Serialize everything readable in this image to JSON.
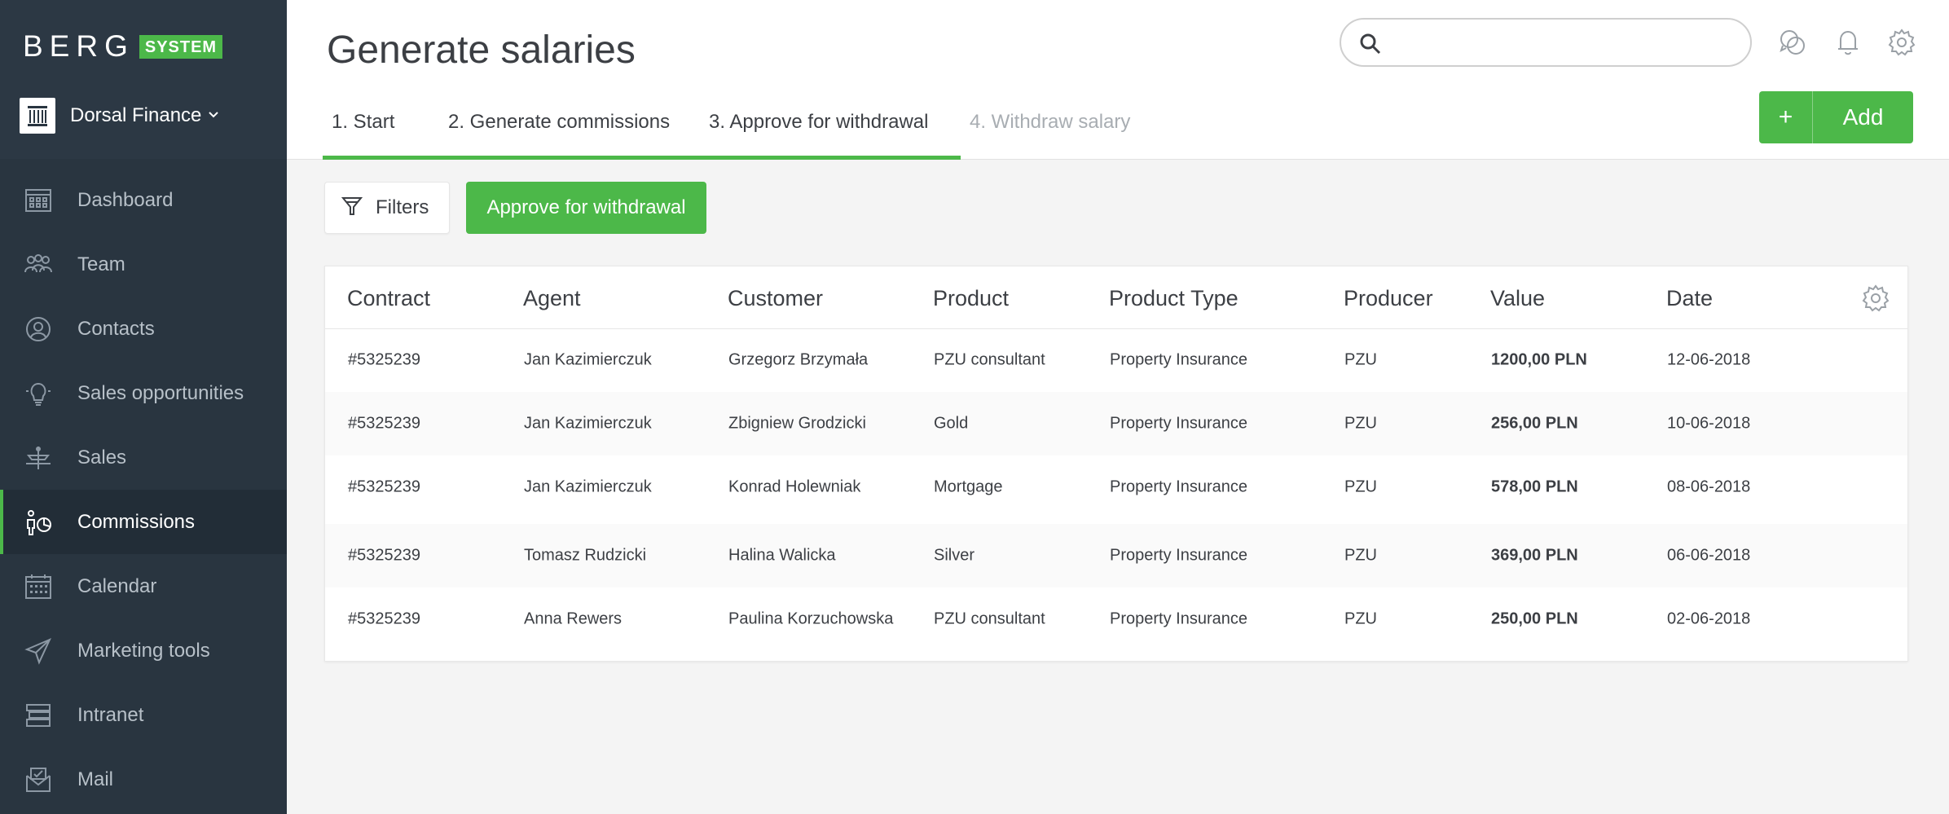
{
  "brand": {
    "word": "BERG",
    "badge": "SYSTEM"
  },
  "company": {
    "name": "Dorsal Finance"
  },
  "sidebar": {
    "items": [
      {
        "label": "Dashboard",
        "icon": "dashboard-icon"
      },
      {
        "label": "Team",
        "icon": "team-icon"
      },
      {
        "label": "Contacts",
        "icon": "contacts-icon"
      },
      {
        "label": "Sales opportunities",
        "icon": "lightbulb-icon"
      },
      {
        "label": "Sales",
        "icon": "sales-icon"
      },
      {
        "label": "Commissions",
        "icon": "commissions-icon",
        "active": true
      },
      {
        "label": "Calendar",
        "icon": "calendar-icon"
      },
      {
        "label": "Marketing tools",
        "icon": "paper-plane-icon"
      },
      {
        "label": "Intranet",
        "icon": "intranet-icon"
      },
      {
        "label": "Mail",
        "icon": "mail-icon"
      }
    ]
  },
  "header": {
    "title": "Generate salaries",
    "search": {
      "placeholder": "",
      "value": ""
    },
    "icons": [
      "chat-icon",
      "bell-icon",
      "gear-icon"
    ],
    "add_label": "Add",
    "add_plus": "+"
  },
  "tabs": [
    {
      "label": "1. Start",
      "state": "done"
    },
    {
      "label": "2. Generate commissions",
      "state": "done"
    },
    {
      "label": "3. Approve for withdrawal",
      "state": "current"
    },
    {
      "label": "4. Withdraw salary",
      "state": "disabled"
    }
  ],
  "toolbar": {
    "filters_label": "Filters",
    "approve_label": "Approve for withdrawal"
  },
  "table": {
    "columns": [
      "Contract",
      "Agent",
      "Customer",
      "Product",
      "Product Type",
      "Producer",
      "Value",
      "Date"
    ],
    "rows": [
      [
        "#5325239",
        "Jan Kazimierczuk",
        "Grzegorz Brzymała",
        "PZU consultant",
        "Property Insurance",
        "PZU",
        "1200,00 PLN",
        "12-06-2018"
      ],
      [
        "#5325239",
        "Jan Kazimierczuk",
        "Zbigniew Grodzicki",
        "Gold",
        "Property Insurance",
        "PZU",
        "256,00 PLN",
        "10-06-2018"
      ],
      [
        "#5325239",
        "Jan Kazimierczuk",
        "Konrad Holewniak",
        "Mortgage",
        "Property Insurance",
        "PZU",
        "578,00 PLN",
        "08-06-2018"
      ],
      [
        "#5325239",
        "Tomasz Rudzicki",
        "Halina Walicka",
        "Silver",
        "Property Insurance",
        "PZU",
        "369,00 PLN",
        "06-06-2018"
      ],
      [
        "#5325239",
        "Anna Rewers",
        "Paulina Korzuchowska",
        "PZU consultant",
        "Property Insurance",
        "PZU",
        "250,00 PLN",
        "02-06-2018"
      ]
    ]
  },
  "colors": {
    "accent": "#4cb849",
    "sidebar_bg": "#293540",
    "sidebar_text": "#b7c0c8",
    "text": "#3c3f44"
  }
}
